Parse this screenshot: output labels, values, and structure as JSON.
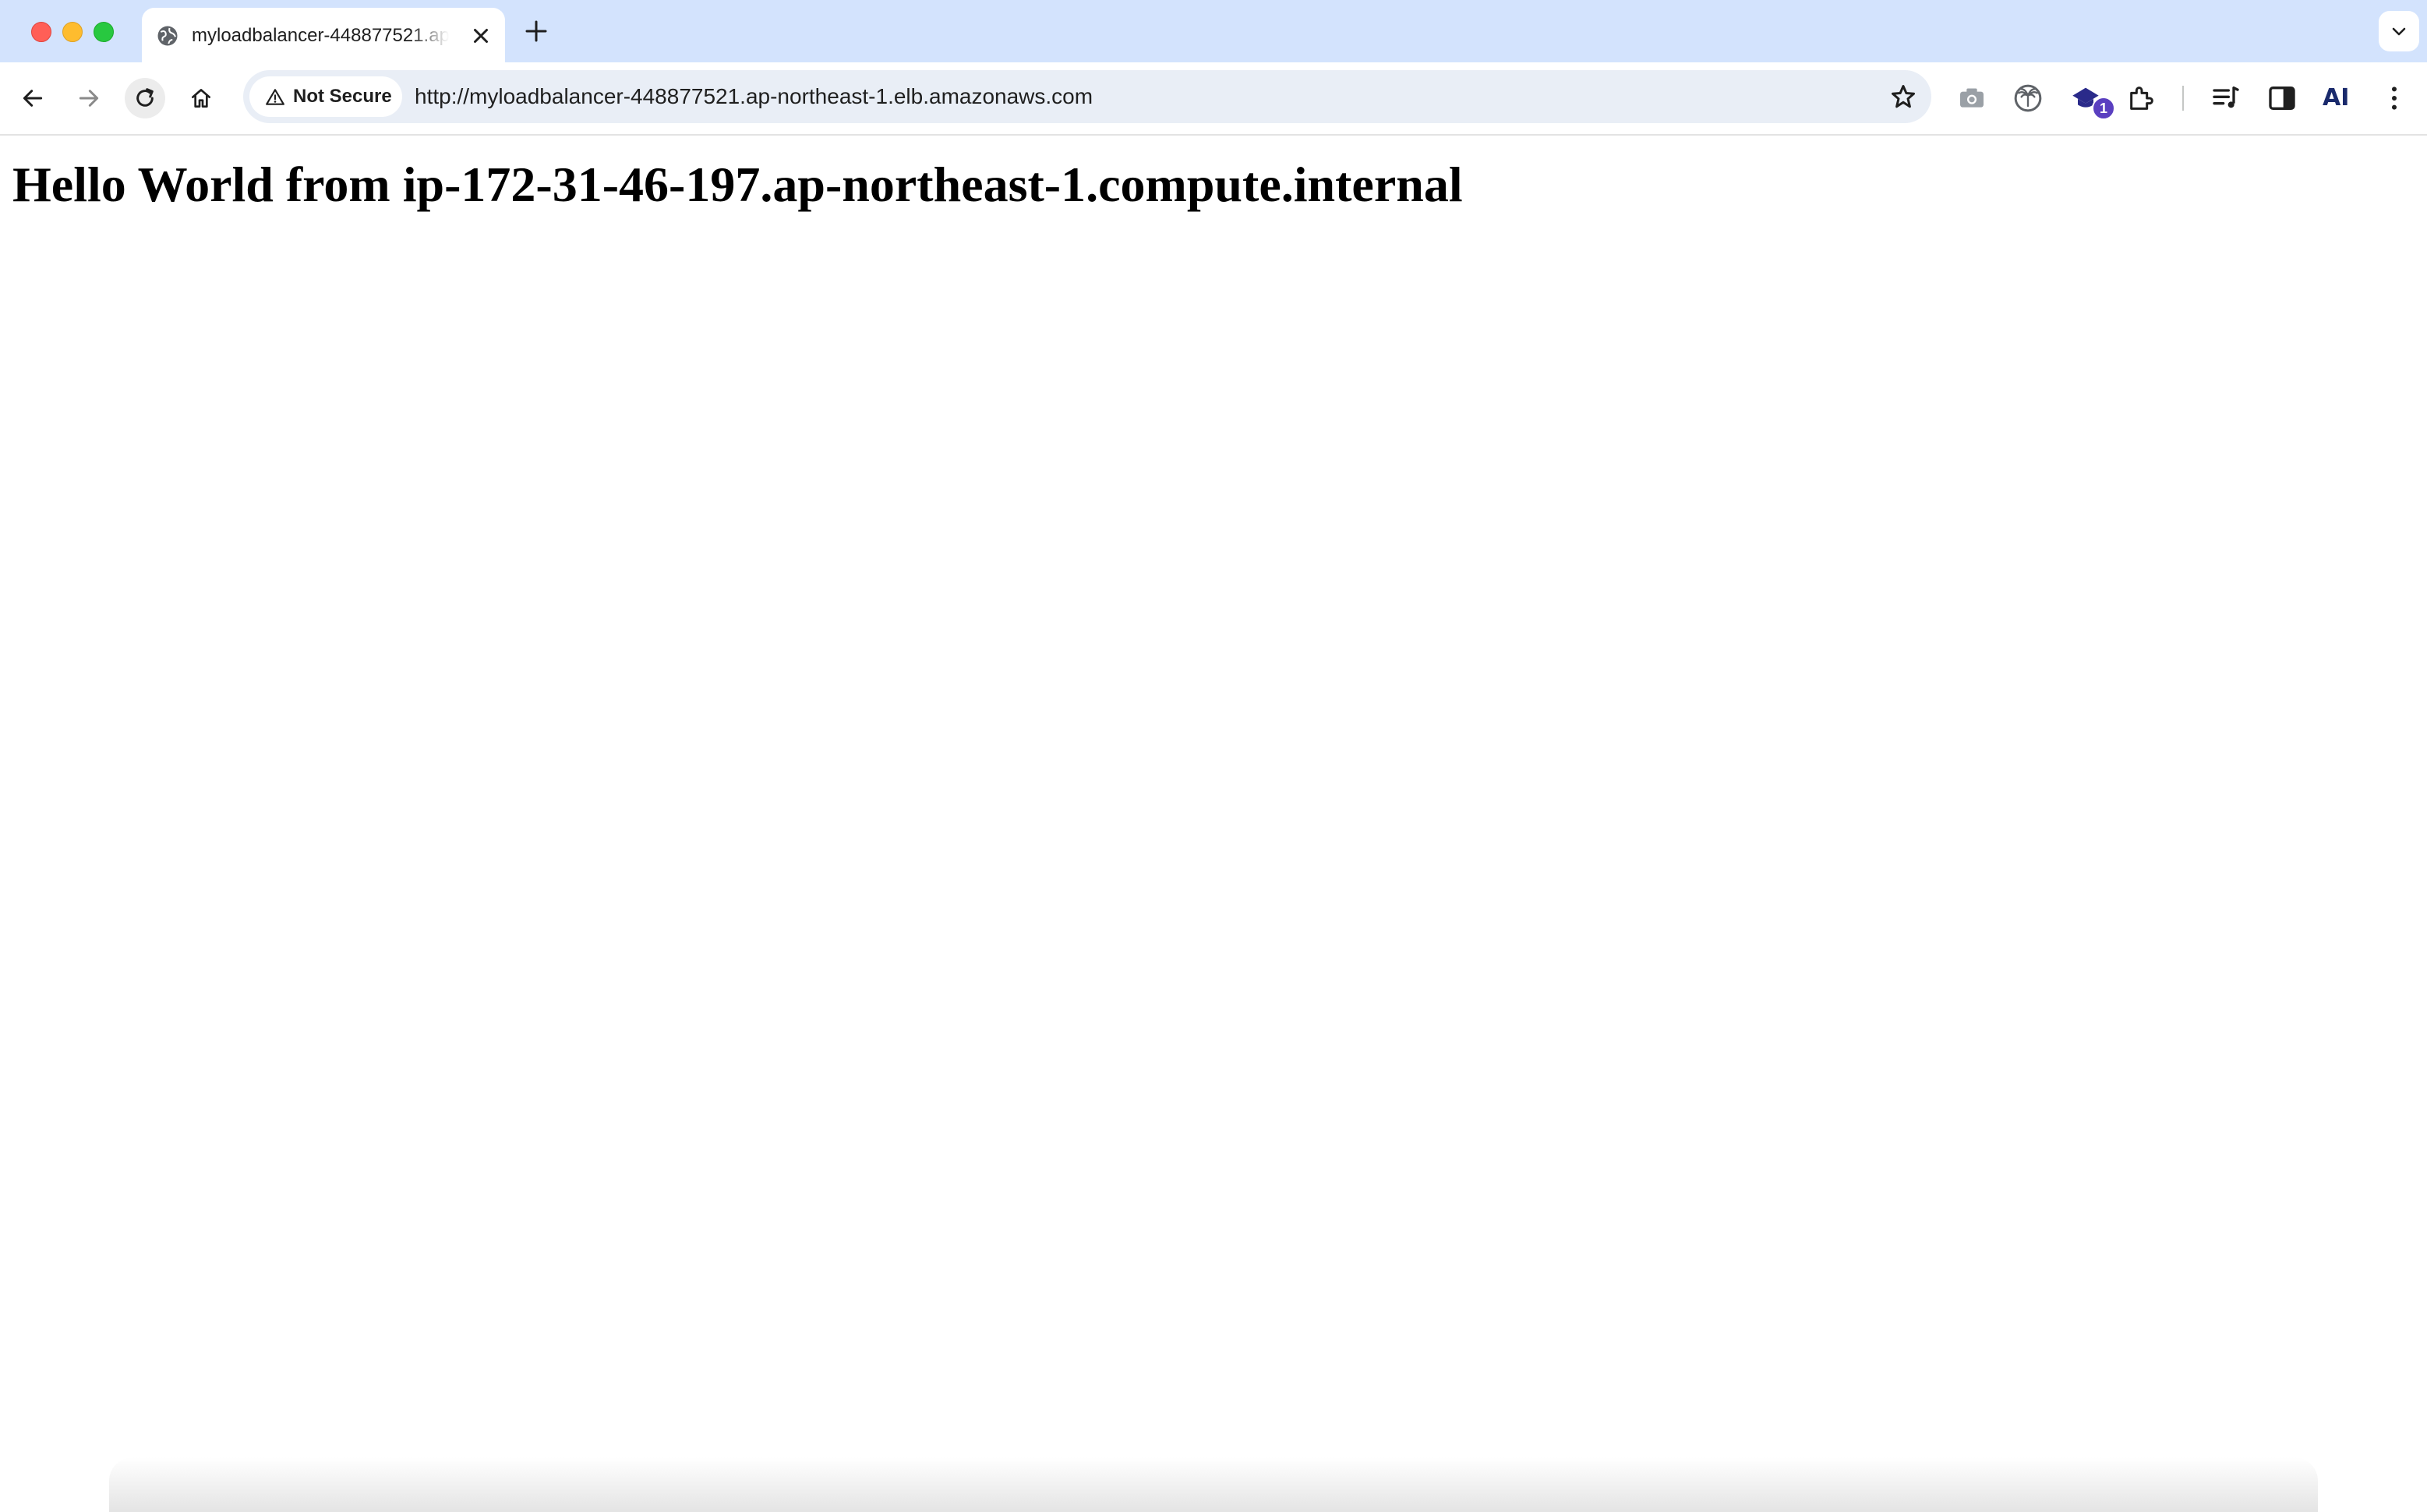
{
  "window": {
    "traffic_lights": [
      "close",
      "minimize",
      "maximize"
    ]
  },
  "tab": {
    "title": "myloadbalancer-448877521.ap-northeast-1.elb.amazonaws.com",
    "favicon": "globe-icon",
    "close_icon": "close-icon"
  },
  "toolbar": {
    "back_icon": "back-arrow-icon",
    "forward_icon": "forward-arrow-icon",
    "reload_icon": "reload-icon",
    "home_icon": "home-icon"
  },
  "omnibox": {
    "security_label": "Not Secure",
    "security_icon": "warning-triangle-icon",
    "url": "http://myloadbalancer-448877521.ap-northeast-1.elb.amazonaws.com",
    "bookmark_icon": "star-icon"
  },
  "extensions": {
    "items": [
      "camera-icon",
      "palm-icon",
      "graduation-cap-extension-icon",
      "puzzle-extensions-icon",
      "media-controls-icon",
      "side-panel-icon"
    ],
    "badge": "1",
    "ai_label": "AI"
  },
  "page": {
    "heading": "Hello World from ip-172-31-46-197.ap-northeast-1.compute.internal"
  },
  "colors": {
    "tabstrip_bg": "#d3e3fd",
    "omnibox_bg": "#e9eef6",
    "badge": "#5a3fc0"
  }
}
